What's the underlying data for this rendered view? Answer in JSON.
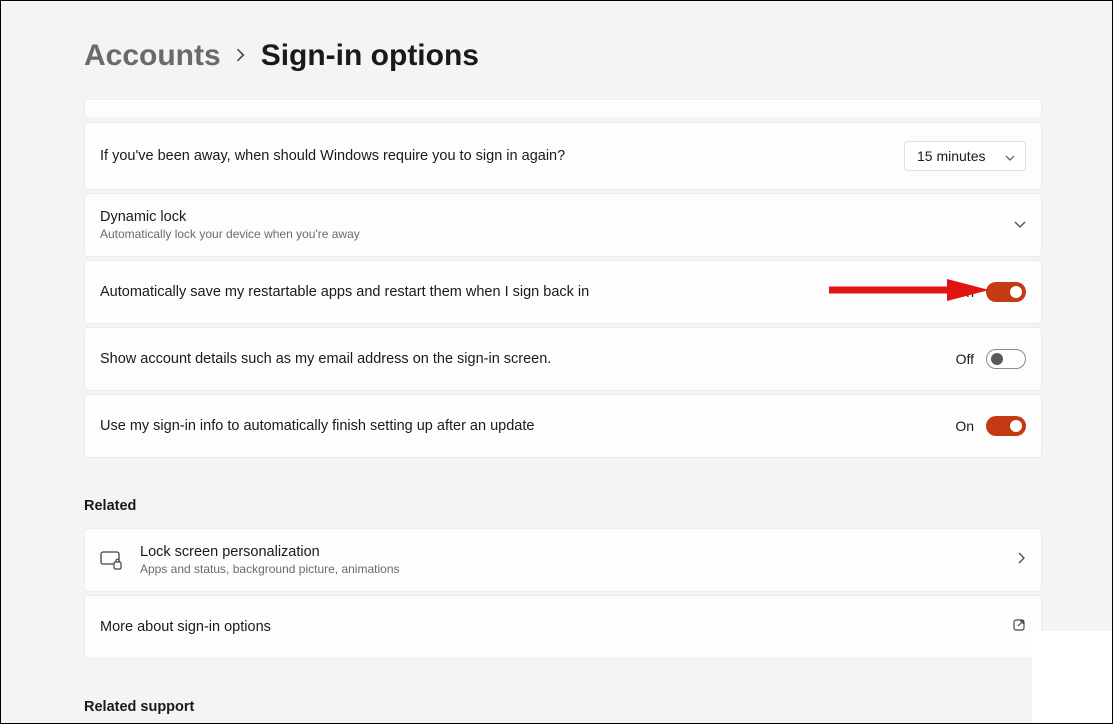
{
  "breadcrumb": {
    "parent": "Accounts",
    "current": "Sign-in options"
  },
  "away": {
    "label": "If you've been away, when should Windows require you to sign in again?",
    "value": "15 minutes"
  },
  "dynamicLock": {
    "title": "Dynamic lock",
    "sub": "Automatically lock your device when you're away"
  },
  "restartApps": {
    "label": "Automatically save my restartable apps and restart them when I sign back in",
    "state": "On"
  },
  "showDetails": {
    "label": "Show account details such as my email address on the sign-in screen.",
    "state": "Off"
  },
  "autoFinish": {
    "label": "Use my sign-in info to automatically finish setting up after an update",
    "state": "On"
  },
  "relatedHead": "Related",
  "lockScreen": {
    "title": "Lock screen personalization",
    "sub": "Apps and status, background picture, animations"
  },
  "moreAbout": "More about sign-in options",
  "relatedSupport": "Related support"
}
